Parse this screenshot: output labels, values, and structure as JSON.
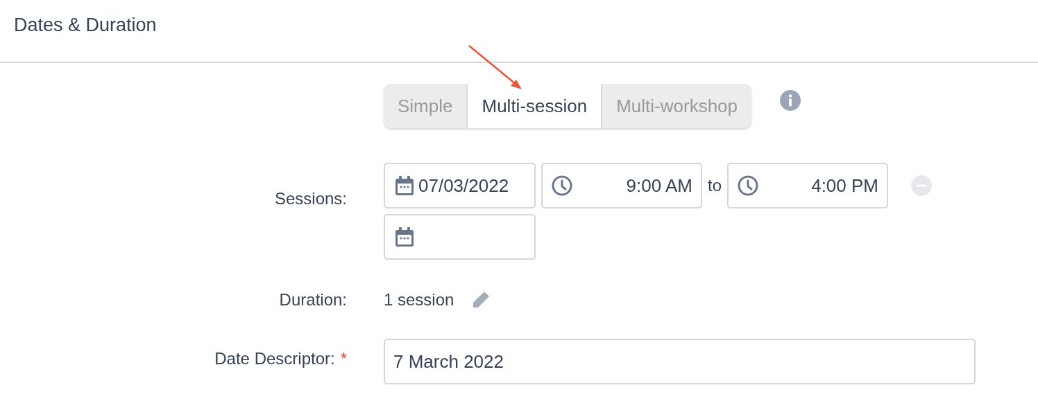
{
  "section": {
    "title": "Dates & Duration"
  },
  "mode_tabs": [
    {
      "label": "Simple",
      "selected": false
    },
    {
      "label": "Multi-session",
      "selected": true
    },
    {
      "label": "Multi-workshop",
      "selected": false
    }
  ],
  "sessions": {
    "label": "Sessions:",
    "rows": [
      {
        "kind": "full",
        "date": "07/03/2022",
        "start_time": "9:00 AM",
        "connector": "to",
        "end_time": "4:00 PM",
        "removable": true
      },
      {
        "kind": "date_only"
      }
    ]
  },
  "duration": {
    "label": "Duration:",
    "value": "1 session"
  },
  "date_descriptor": {
    "label": "Date Descriptor:",
    "required": true,
    "required_mark": "*",
    "value": "7 March 2022"
  }
}
